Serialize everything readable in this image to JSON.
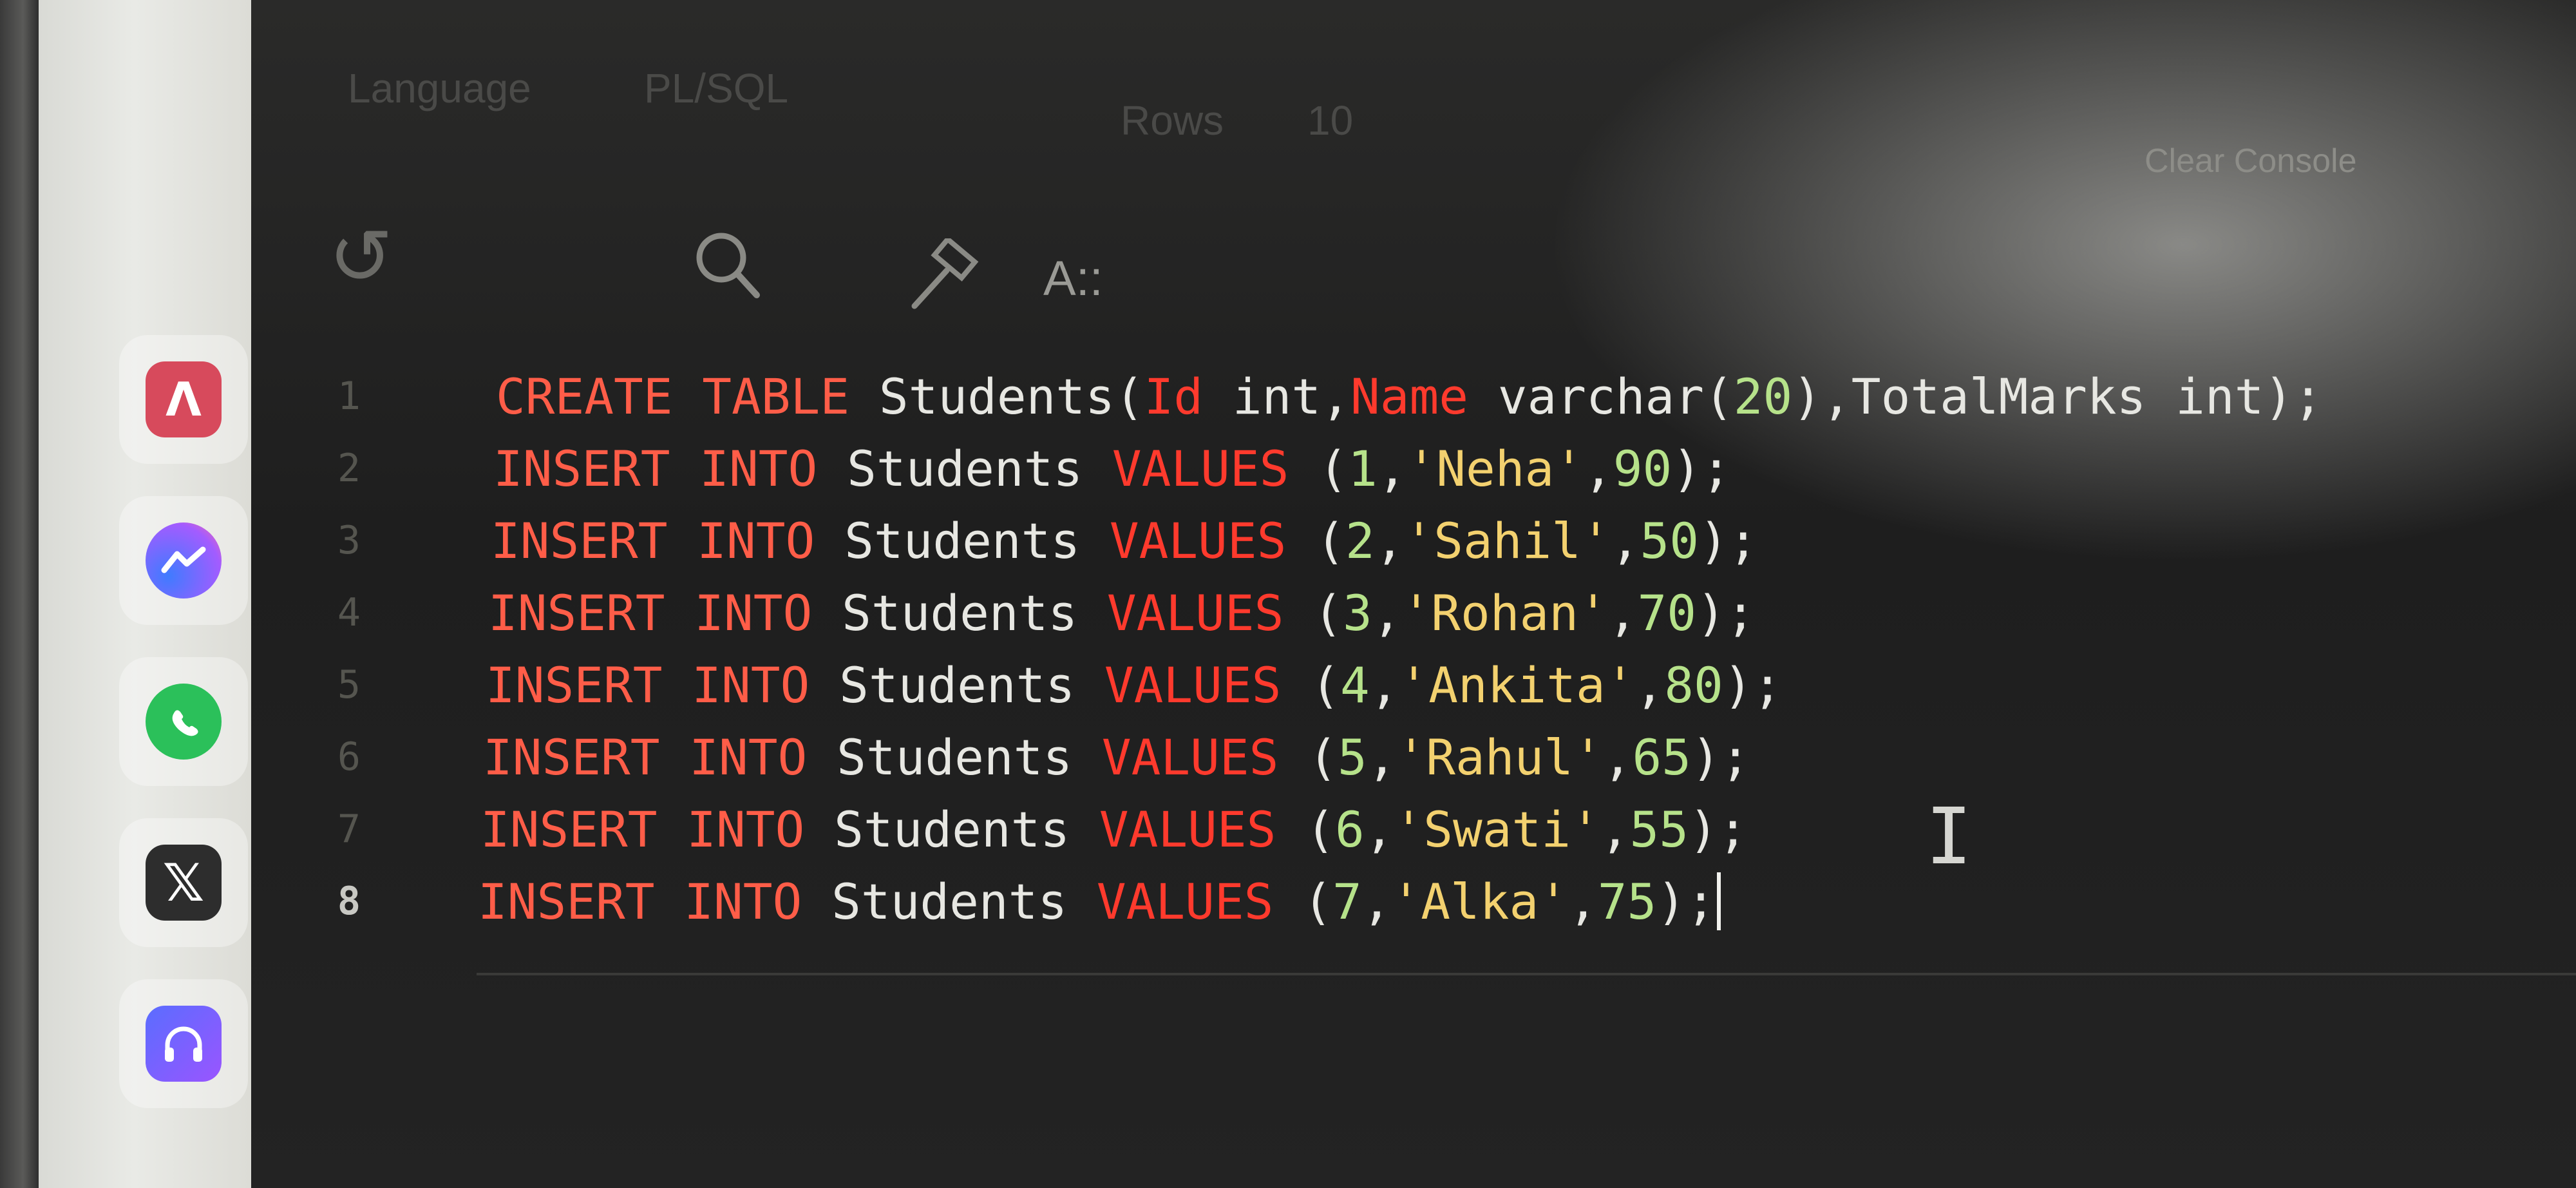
{
  "toolbar": {
    "language_label": "Language",
    "language_value": "PL/SQL",
    "rows_label": "Rows",
    "rows_value": "10",
    "clear_label": "Clear Console"
  },
  "toolbar_icons": [
    "undo-icon",
    "search-icon",
    "hammer-icon",
    "format-icon"
  ],
  "format_icon_text": "A::",
  "dock": {
    "apps": [
      "app-icon-a",
      "messenger-icon",
      "whatsapp-icon",
      "x-icon",
      "headphones-icon"
    ]
  },
  "editor": {
    "lines": [
      {
        "n": "1",
        "parts": [
          {
            "t": "CREATE TABLE ",
            "c": "kw"
          },
          {
            "t": "Students(",
            "c": ""
          },
          {
            "t": "Id",
            "c": "kw2"
          },
          {
            "t": " int,",
            "c": ""
          },
          {
            "t": "Name",
            "c": "kw2"
          },
          {
            "t": " varchar(",
            "c": ""
          },
          {
            "t": "20",
            "c": "num"
          },
          {
            "t": "),TotalMarks int);",
            "c": ""
          }
        ]
      },
      {
        "n": "2",
        "parts": [
          {
            "t": "INSERT INTO ",
            "c": "kw"
          },
          {
            "t": "Students ",
            "c": ""
          },
          {
            "t": "VALUES",
            "c": "kw2"
          },
          {
            "t": " (",
            "c": ""
          },
          {
            "t": "1",
            "c": "num"
          },
          {
            "t": ",",
            "c": ""
          },
          {
            "t": "'Neha'",
            "c": "str"
          },
          {
            "t": ",",
            "c": ""
          },
          {
            "t": "90",
            "c": "num"
          },
          {
            "t": ");",
            "c": ""
          }
        ]
      },
      {
        "n": "3",
        "parts": [
          {
            "t": "INSERT INTO ",
            "c": "kw"
          },
          {
            "t": "Students ",
            "c": ""
          },
          {
            "t": "VALUES",
            "c": "kw2"
          },
          {
            "t": " (",
            "c": ""
          },
          {
            "t": "2",
            "c": "num"
          },
          {
            "t": ",",
            "c": ""
          },
          {
            "t": "'Sahil'",
            "c": "str"
          },
          {
            "t": ",",
            "c": ""
          },
          {
            "t": "50",
            "c": "num"
          },
          {
            "t": ");",
            "c": ""
          }
        ]
      },
      {
        "n": "4",
        "parts": [
          {
            "t": "INSERT INTO ",
            "c": "kw"
          },
          {
            "t": "Students ",
            "c": ""
          },
          {
            "t": "VALUES",
            "c": "kw2"
          },
          {
            "t": " (",
            "c": ""
          },
          {
            "t": "3",
            "c": "num"
          },
          {
            "t": ",",
            "c": ""
          },
          {
            "t": "'Rohan'",
            "c": "str"
          },
          {
            "t": ",",
            "c": ""
          },
          {
            "t": "70",
            "c": "num"
          },
          {
            "t": ");",
            "c": ""
          }
        ]
      },
      {
        "n": "5",
        "parts": [
          {
            "t": "INSERT INTO ",
            "c": "kw"
          },
          {
            "t": "Students ",
            "c": ""
          },
          {
            "t": "VALUES",
            "c": "kw2"
          },
          {
            "t": " (",
            "c": ""
          },
          {
            "t": "4",
            "c": "num"
          },
          {
            "t": ",",
            "c": ""
          },
          {
            "t": "'Ankita'",
            "c": "str"
          },
          {
            "t": ",",
            "c": ""
          },
          {
            "t": "80",
            "c": "num"
          },
          {
            "t": ");",
            "c": ""
          }
        ]
      },
      {
        "n": "6",
        "parts": [
          {
            "t": "INSERT INTO ",
            "c": "kw"
          },
          {
            "t": "Students ",
            "c": ""
          },
          {
            "t": "VALUES",
            "c": "kw2"
          },
          {
            "t": " (",
            "c": ""
          },
          {
            "t": "5",
            "c": "num"
          },
          {
            "t": ",",
            "c": ""
          },
          {
            "t": "'Rahul'",
            "c": "str"
          },
          {
            "t": ",",
            "c": ""
          },
          {
            "t": "65",
            "c": "num"
          },
          {
            "t": ");",
            "c": ""
          }
        ]
      },
      {
        "n": "7",
        "parts": [
          {
            "t": "INSERT INTO ",
            "c": "kw"
          },
          {
            "t": "Students ",
            "c": ""
          },
          {
            "t": "VALUES",
            "c": "kw2"
          },
          {
            "t": " (",
            "c": ""
          },
          {
            "t": "6",
            "c": "num"
          },
          {
            "t": ",",
            "c": ""
          },
          {
            "t": "'Swati'",
            "c": "str"
          },
          {
            "t": ",",
            "c": ""
          },
          {
            "t": "55",
            "c": "num"
          },
          {
            "t": ");",
            "c": ""
          }
        ]
      },
      {
        "n": "8",
        "parts": [
          {
            "t": "INSERT INTO ",
            "c": "kw"
          },
          {
            "t": "Students ",
            "c": ""
          },
          {
            "t": "VALUES",
            "c": "kw2"
          },
          {
            "t": " (",
            "c": ""
          },
          {
            "t": "7",
            "c": "num"
          },
          {
            "t": ",",
            "c": ""
          },
          {
            "t": "'Alka'",
            "c": "str"
          },
          {
            "t": ",",
            "c": ""
          },
          {
            "t": "75",
            "c": "num"
          },
          {
            "t": ");",
            "c": ""
          }
        ]
      }
    ],
    "active_line": "8"
  },
  "colors": {
    "keyword": "#ff5d48",
    "keyword_strong": "#ff3a2d",
    "string": "#f3d16f",
    "number": "#b6e28a",
    "text": "#e7e7e2"
  }
}
